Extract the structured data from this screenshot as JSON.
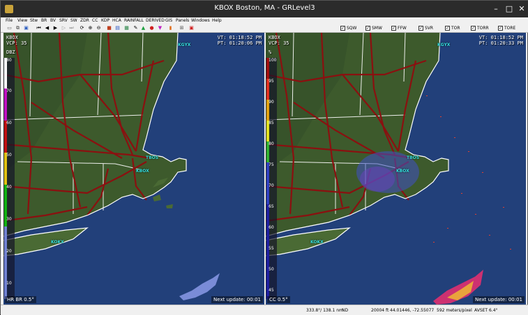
{
  "window": {
    "title": "KBOX Boston, MA - GRLevel3",
    "minimize": "–",
    "maximize": "□",
    "close": "✕"
  },
  "menu": [
    "File",
    "View",
    "Stw",
    "BR",
    "BV",
    "SRV",
    "SW",
    "ZDR",
    "CC",
    "KDP",
    "HCA",
    "RAINFALL",
    "DERIVED",
    "GIS",
    "Panels",
    "Windows",
    "Help"
  ],
  "alerts": [
    {
      "label": "SQW",
      "checked": true
    },
    {
      "label": "SMW",
      "checked": true
    },
    {
      "label": "FFW",
      "checked": true
    },
    {
      "label": "SVR",
      "checked": true
    },
    {
      "label": "TOR",
      "checked": true
    },
    {
      "label": "TORR",
      "checked": true
    },
    {
      "label": "TORE",
      "checked": true
    }
  ],
  "left_pane": {
    "station": "KBOX",
    "vcp": "VCP: 35",
    "units": "DBZ",
    "vt": "VT: 01:18:52 PM",
    "pt": "PT: 01:20:06 PM",
    "product": "HR BR 0.5°",
    "next_update": "Next update: 00:01",
    "legend_ticks": [
      "80",
      "70",
      "60",
      "50",
      "40",
      "30",
      "20",
      "10"
    ]
  },
  "right_pane": {
    "station": "KBOX",
    "vcp": "VCP: 35",
    "units": "%",
    "vt": "VT: 01:18:52 PM",
    "pt": "PT: 01:20:33 PM",
    "product": "CC 0.5°",
    "next_update": "Next update: 00:01",
    "legend_ticks": [
      "100",
      "95",
      "90",
      "85",
      "80",
      "75",
      "70",
      "65",
      "60",
      "55",
      "50",
      "45"
    ]
  },
  "cities": {
    "kgyx": "KGYX",
    "tbos": "TBOS",
    "kbox": "KBOX",
    "kokx": "KOKX"
  },
  "status": {
    "az_range": "333.8°/ 138.1 nm",
    "nd": "ND",
    "height": "20004 ft",
    "latlon": "44.01446, -72.55077",
    "scale": "592 meters/pixel",
    "avset": "AVSET 6.4°"
  },
  "colors": {
    "map_land": "#3f5a2e",
    "ocean": "#22407a",
    "highway": "#8b1010",
    "border": "#ffffff",
    "city_label": "#33e0e0"
  }
}
